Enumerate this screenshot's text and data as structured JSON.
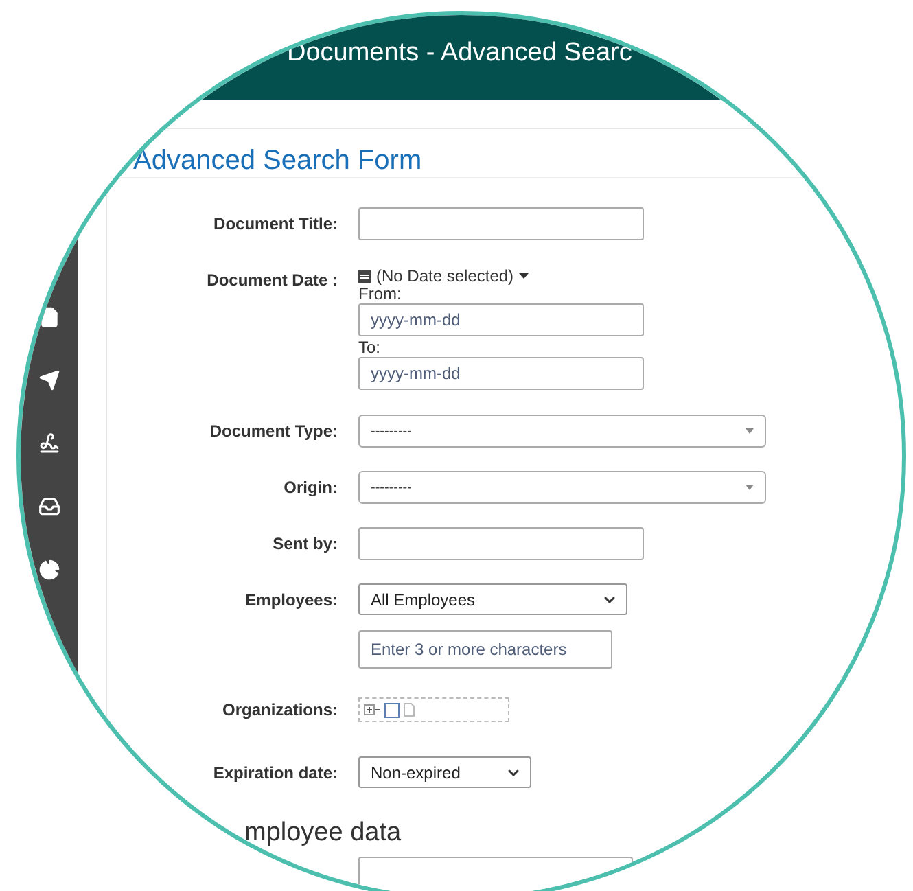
{
  "header": {
    "title": "Documents - Advanced Searc"
  },
  "sidebar": {
    "items": [
      {
        "kind": "file"
      },
      {
        "kind": "send"
      },
      {
        "kind": "signature"
      },
      {
        "kind": "inbox"
      },
      {
        "kind": "chart"
      }
    ]
  },
  "page_heading": "Advanced Search Form",
  "fields": [
    {
      "kind": "text",
      "label": "Document Title:"
    },
    {
      "kind": "date",
      "label": "Document Date :",
      "range_label": "(No Date selected)",
      "from_label": "From:",
      "from_placeholder": "yyyy-mm-dd",
      "to_label": "To:",
      "to_placeholder": "yyyy-mm-dd"
    },
    {
      "kind": "combo",
      "label": "Document Type:",
      "value": "---------"
    },
    {
      "kind": "combo",
      "label": "Origin:",
      "value": "---------"
    },
    {
      "kind": "text",
      "label": "Sent by:"
    },
    {
      "kind": "employees",
      "label": "Employees:",
      "value": "All Employees",
      "search_placeholder": "Enter 3 or more characters"
    },
    {
      "kind": "tree",
      "label": "Organizations:",
      "checked": false
    },
    {
      "kind": "select",
      "label": "Expiration date:",
      "value": "Non-expired"
    }
  ],
  "section_heading": "mployee data"
}
